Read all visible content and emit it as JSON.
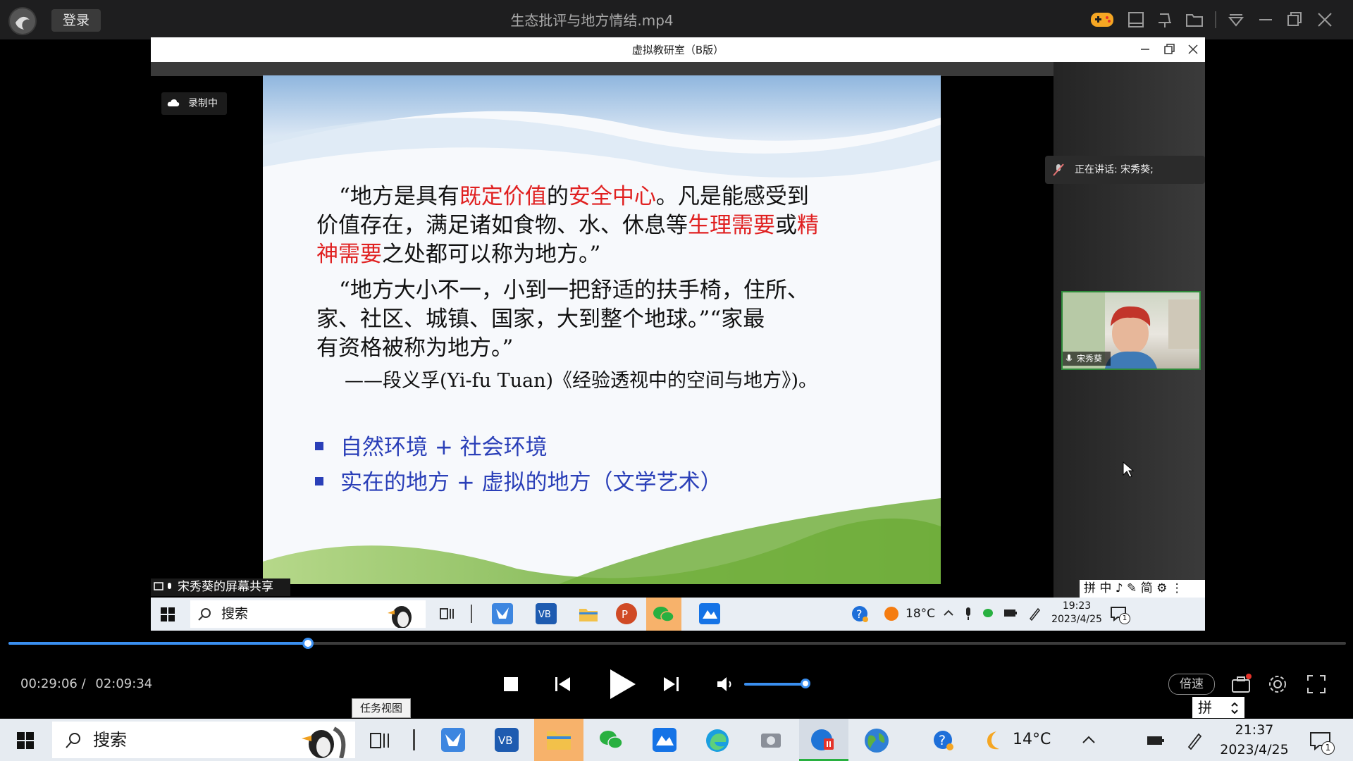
{
  "player": {
    "login_label": "登录",
    "video_title": "生态批评与地方情结.mp4",
    "progress_fraction": 0.224,
    "current_time": "00:29:06 /",
    "total_time": "02:09:34",
    "speed_label": "倍速",
    "volume_fraction": 0.85,
    "icons": [
      "gamepad-icon",
      "note-icon",
      "pin-icon",
      "folder-icon",
      "dropdown-icon",
      "minimize-icon",
      "restore-icon",
      "close-icon"
    ]
  },
  "remote": {
    "window_title": "虚拟教研室（B版）",
    "recording_label": "录制中",
    "speaker_label": "正在讲话: 宋秀葵;",
    "participant_name": "宋秀葵",
    "share_label": "宋秀葵的屏幕共享",
    "ime_text": "拼 中 ♪ ✎ 简 ⚙ ⋮",
    "taskbar": {
      "search_label": "搜索",
      "weather": "18°C",
      "time": "19:23",
      "date": "2023/4/25",
      "notification_count": "1"
    }
  },
  "slide": {
    "p1": [
      {
        "t": "“地方是具有",
        "red": false
      },
      {
        "t": "既定价值",
        "red": true
      },
      {
        "t": "的",
        "red": false
      },
      {
        "t": "安全中心",
        "red": true
      },
      {
        "t": "。凡是能感受到",
        "red": false
      }
    ],
    "p1_line2": [
      {
        "t": "价值存在，满足诸如食物、水、休息等",
        "red": false
      },
      {
        "t": "生理需要",
        "red": true
      },
      {
        "t": "或",
        "red": false
      },
      {
        "t": "精",
        "red": true
      }
    ],
    "p1_line3": [
      {
        "t": "神需要",
        "red": true
      },
      {
        "t": "之处都可以称为地方。”",
        "red": false
      }
    ],
    "p2_line1": "“地方大小不一，小到一把舒适的扶手椅，住所、",
    "p2_line2": "家、社区、城镇、国家，大到整个地球。”“家最",
    "p2_line3": "有资格被称为地方。”",
    "attribution": "——段义孚(Yi-fu Tuan)《经验透视中的空间与地方》)。",
    "bullets": [
      "自然环境 + 社会环境",
      "实在的地方 + 虚拟的地方（文学艺术）"
    ]
  },
  "host": {
    "tooltip": "任务视图",
    "ime_text": "拼",
    "taskbar": {
      "search_label": "搜索",
      "weather": "14°C",
      "time": "21:37",
      "date": "2023/4/25",
      "notification_count": "1"
    }
  },
  "colors": {
    "accent_blue": "#3a8ff0",
    "slide_red": "#e02020",
    "bullet_blue": "#2a3fb8"
  }
}
